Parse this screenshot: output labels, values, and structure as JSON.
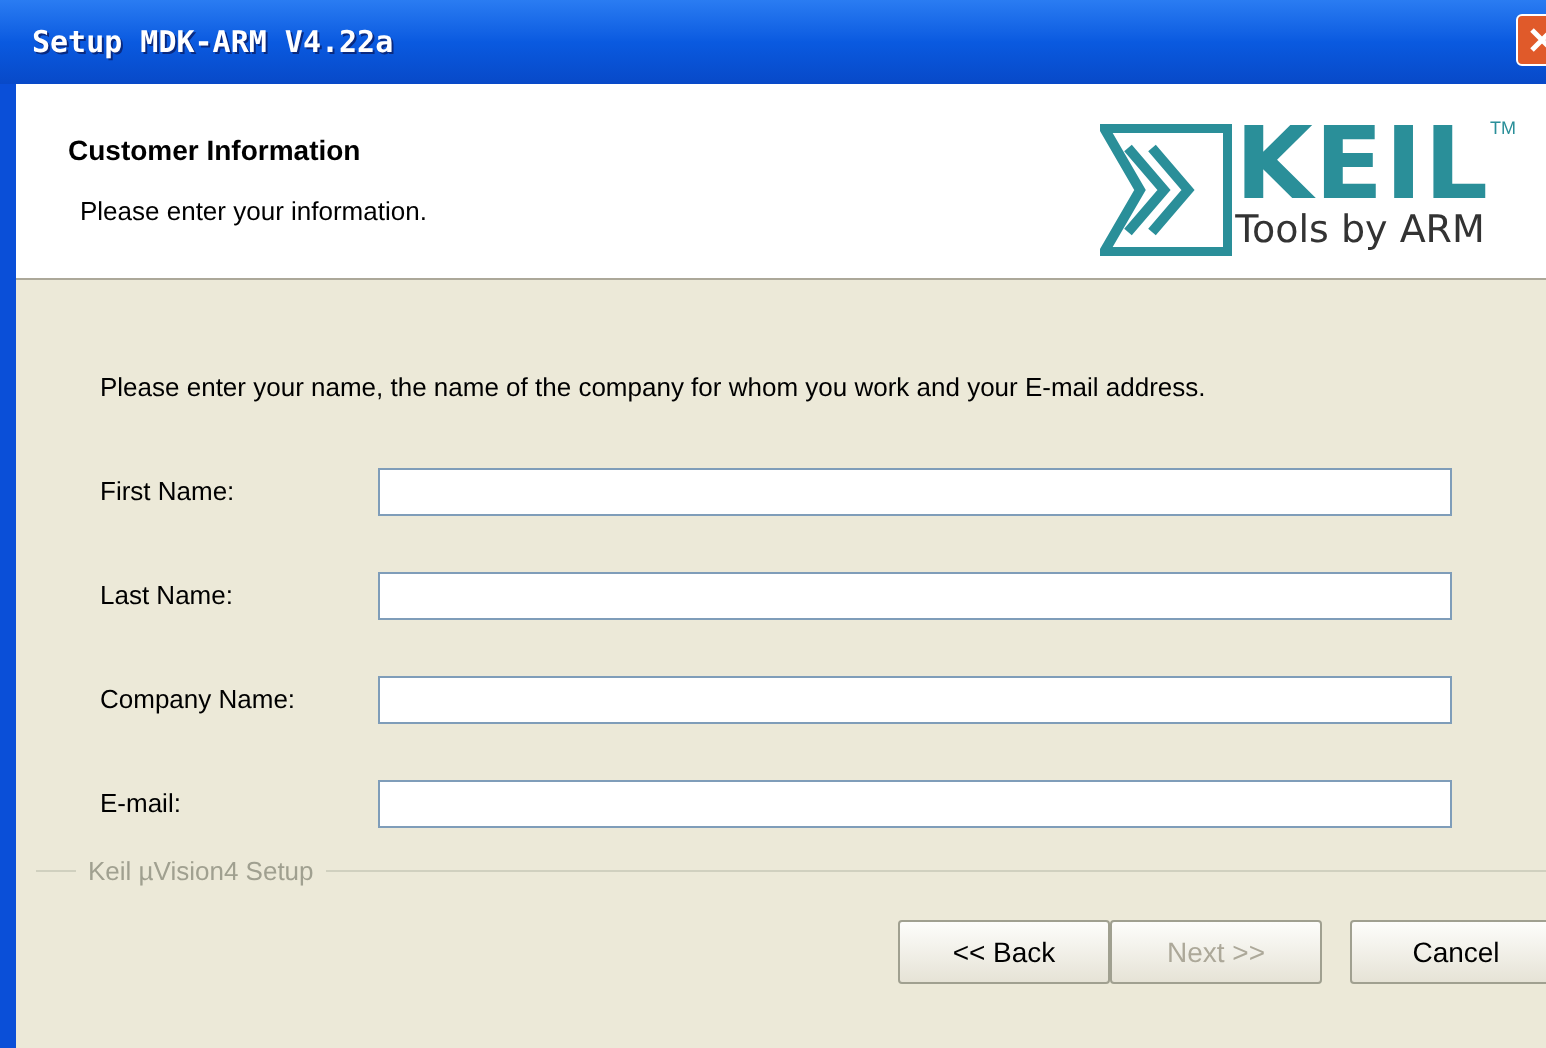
{
  "window": {
    "title": "Setup MDK-ARM V4.22a"
  },
  "header": {
    "title": "Customer Information",
    "subtitle": "Please enter your information.",
    "logo": {
      "name": "KEIL",
      "trademark": "TM",
      "tagline": "Tools by ARM"
    }
  },
  "instruction": "Please enter your name, the name of the company for whom you work and your E-mail address.",
  "fields": [
    {
      "label": "First Name:"
    },
    {
      "label": "Last Name:"
    },
    {
      "label": "Company Name:"
    },
    {
      "label": "E-mail:"
    }
  ],
  "group_label": "Keil µVision4 Setup",
  "buttons": [
    {
      "label": "<< Back",
      "disabled": false
    },
    {
      "label": "Next >>",
      "disabled": true
    },
    {
      "label": "Cancel",
      "disabled": false
    }
  ]
}
